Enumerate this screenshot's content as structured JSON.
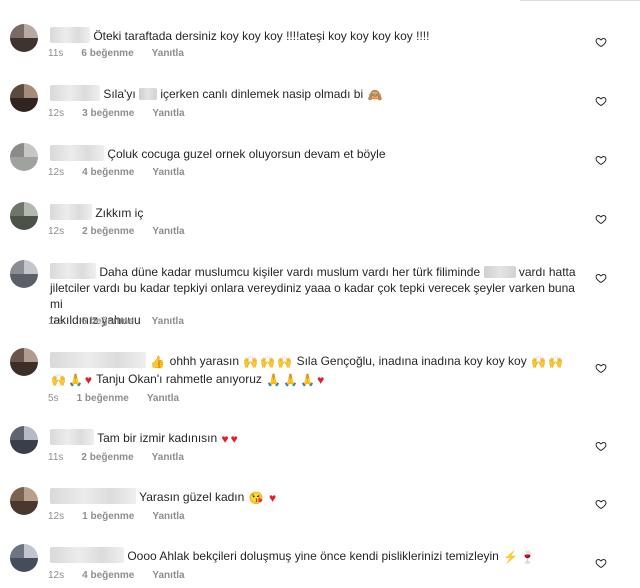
{
  "labels": {
    "likes_suffix": "beğenme",
    "reply": "Yanıtla"
  },
  "comments": [
    {
      "time": "11s",
      "likes": "6 beğenme",
      "line1": "Öteki taraftada dersiniz koy koy koy !!!!ateşi koy koy koy koy !!!!"
    },
    {
      "time": "12s",
      "likes": "3 beğenme",
      "text_a": "Sıla'yı",
      "text_b": "içerken canlı dinlemek nasip olmadı bi",
      "emoji": "monkey-emoji"
    },
    {
      "time": "12s",
      "likes": "4 beğenme",
      "line1": "Çoluk cocuga guzel ornek oluyorsun devam et böyle"
    },
    {
      "time": "12s",
      "likes": "2 beğenme",
      "line1": "Zıkkım iç"
    },
    {
      "time": "11s",
      "likes": "6 beğenme",
      "line1_a": "Daha düne kadar muslumcu kişiler vardı muslum vardı her türk filiminde",
      "line1_b": "vardı hatta",
      "line2": "jiletciler vardı bu kadar tepkiyi onlara vereydiniz yaaa o kadar çok tepki verecek şeyler varken buna mi",
      "line3": "takıldınız yahuuu"
    },
    {
      "time": "5s",
      "likes": "1 beğenme",
      "line1_a": "ohhh yarasın",
      "line1_b": "Sıla Gençoğlu, inadına inadına koy koy koy",
      "line2": "Tanju Okan'ı rahmetle anıyoruz"
    },
    {
      "time": "11s",
      "likes": "2 beğenme",
      "line1": "Tam bir izmir kadınısın"
    },
    {
      "time": "12s",
      "likes": "1 beğenme",
      "line1": "Yarasın güzel kadın"
    },
    {
      "time": "12s",
      "likes": "4 beğenme",
      "line1": "Oooo Ahlak bekçileri doluşmuş yine önce kendi pisliklerinizi temizleyin"
    }
  ],
  "colors": {
    "text": "#262626",
    "meta": "#8e8e8e",
    "divider": "#dbdbdb",
    "emoji_heart": "#e0202f"
  },
  "icons": [
    "heart-outline-icon",
    "red-heart-emoji",
    "folded-hands-emoji",
    "raising-hands-emoji",
    "thumbs-up-emoji",
    "kissing-face-emoji",
    "lightning-emoji",
    "wine-glass-emoji",
    "see-no-evil-monkey-emoji"
  ]
}
